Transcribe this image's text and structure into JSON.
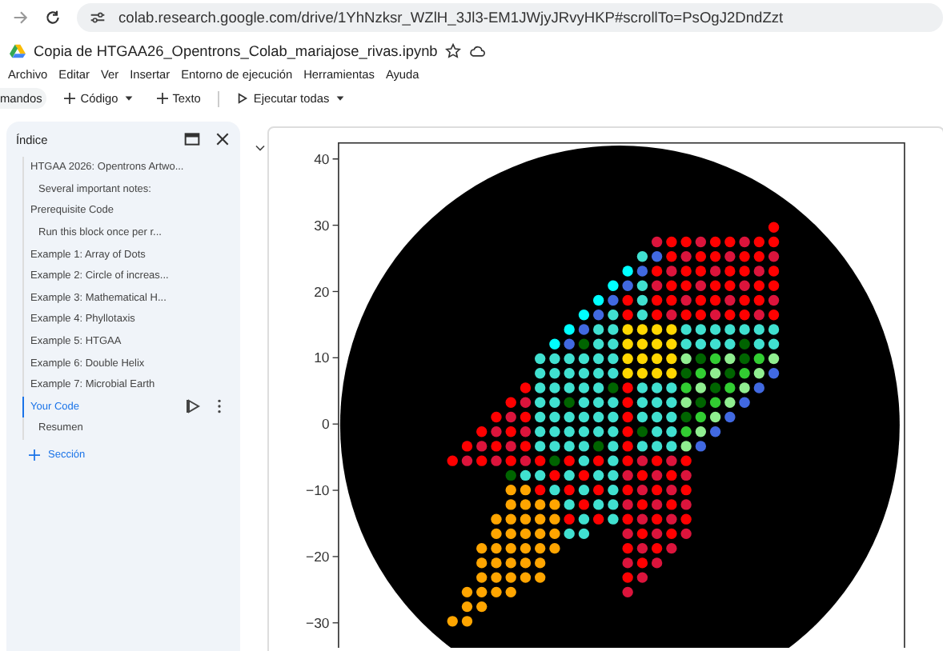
{
  "browser": {
    "url": "colab.research.google.com/drive/1YhNzksr_WZlH_3Jl3-EM1JWjyJRvyHKP#scrollTo=PsOgJ2DndZzt"
  },
  "notebook": {
    "title": "Copia de HTGAA26_Opentrons_Colab_mariajose_rivas.ipynb",
    "menu": [
      "Archivo",
      "Editar",
      "Ver",
      "Insertar",
      "Entorno de ejecución",
      "Herramientas",
      "Ayuda"
    ],
    "toolbar": [
      {
        "kind": "plain",
        "label": "mandos",
        "dropdown": false
      },
      {
        "kind": "add",
        "label": "Código",
        "dropdown": true
      },
      {
        "kind": "add",
        "label": "Texto",
        "dropdown": false
      },
      {
        "kind": "run",
        "label": "Ejecutar todas",
        "dropdown": true
      }
    ]
  },
  "toc": {
    "title": "Índice",
    "items": [
      {
        "label": "HTGAA 2026: Opentrons Artwo...",
        "selected": false,
        "children": [
          {
            "label": "Several important notes:",
            "selected": false
          }
        ]
      },
      {
        "label": "Prerequisite Code",
        "selected": false,
        "children": [
          {
            "label": "Run this block once per r...",
            "selected": false
          }
        ]
      },
      {
        "label": "Example 1: Array of Dots",
        "selected": false
      },
      {
        "label": "Example 2: Circle of increas...",
        "selected": false
      },
      {
        "label": "Example 3: Mathematical H...",
        "selected": false
      },
      {
        "label": "Example 4: Phyllotaxis",
        "selected": false
      },
      {
        "label": "Example 5: HTGAA",
        "selected": false
      },
      {
        "label": "Example 6: Double Helix",
        "selected": false
      },
      {
        "label": "Example 7: Microbial Earth",
        "selected": false
      },
      {
        "label": "Your Code",
        "selected": true,
        "children": [
          {
            "label": "Resumen",
            "selected": false
          }
        ]
      }
    ],
    "add_section": "Sección"
  },
  "plot": {
    "y_tick_labels": [
      "40",
      "30",
      "20",
      "10",
      "0",
      "−10",
      "−20",
      "−30"
    ]
  }
}
